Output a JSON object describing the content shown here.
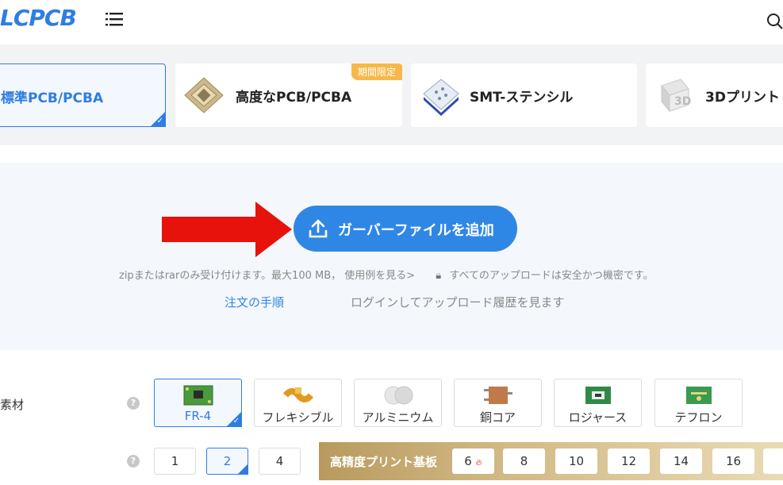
{
  "header": {
    "logo": "LCPCB",
    "menu_icon": "hamburger-menu-icon",
    "search_icon": "search-icon"
  },
  "tabs": [
    {
      "label": "標準PCB/PCBA",
      "active": true
    },
    {
      "label": "高度なPCB/PCBA",
      "badge": "期間限定"
    },
    {
      "label": "SMT-ステンシル"
    },
    {
      "label": "3Dプリント"
    }
  ],
  "upload": {
    "button_label": "ガーバーファイルを追加",
    "note": "zipまたはrarのみ受け付けます。最大100 MB， 使用例を見る>",
    "secure_note": "すべてのアップロードは安全かつ機密です。",
    "order_link": "注文の手順",
    "history_link": "ログインしてアップロード履歴を見ます"
  },
  "material": {
    "label": "素材",
    "options": [
      "FR-4",
      "フレキシブル",
      "アルミニウム",
      "銅コア",
      "ロジャース",
      "テフロン"
    ],
    "selected": "FR-4"
  },
  "layers": {
    "options": [
      "1",
      "2",
      "4"
    ],
    "selected": "2",
    "high_precision_label": "高精度プリント基板",
    "high_precision_options": [
      "6",
      "8",
      "10",
      "12",
      "14",
      "16"
    ]
  },
  "colors": {
    "accent": "#2f7de1",
    "button": "#2f87e5",
    "arrow": "#e8120c",
    "badge": "#f7b84a"
  }
}
